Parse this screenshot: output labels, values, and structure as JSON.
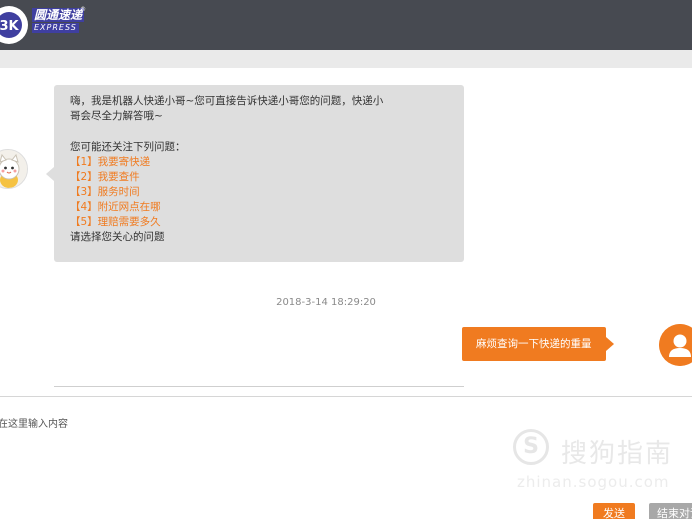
{
  "header": {
    "logo_cn": "圆通速递",
    "logo_en": "EXPRESS",
    "logo_reg": "®"
  },
  "chat": {
    "bot_greeting": [
      "嗨，我是机器人快递小哥~您可直接告诉快递小哥您的问题，快递小",
      "哥会尽全力解答哦~"
    ],
    "faq_intro": "您可能还关注下列问题：",
    "faq_items": [
      {
        "label": "【1】我要寄快递"
      },
      {
        "label": "【2】我要查件"
      },
      {
        "label": "【3】服务时间"
      },
      {
        "label": "【4】附近网点在哪"
      },
      {
        "label": "【5】理赔需要多久"
      }
    ],
    "faq_outro": "请选择您关心的问题",
    "timestamp": "2018-3-14 18:29:20",
    "user_message": "麻烦查询一下快递的重量"
  },
  "input": {
    "placeholder": "在这里输入内容"
  },
  "watermark": {
    "logo_char": "S",
    "text_cn": "搜狗指南",
    "text_en": "zhinan.sogou.com"
  },
  "buttons": {
    "send": "发送",
    "end": "结束对话"
  },
  "colors": {
    "accent": "#f07b20",
    "header_bg": "#474a51",
    "bubble_bg": "#dedede"
  },
  "icons": {
    "bot_avatar": "cartoon-cat-icon",
    "user_avatar": "user-silhouette-icon"
  }
}
